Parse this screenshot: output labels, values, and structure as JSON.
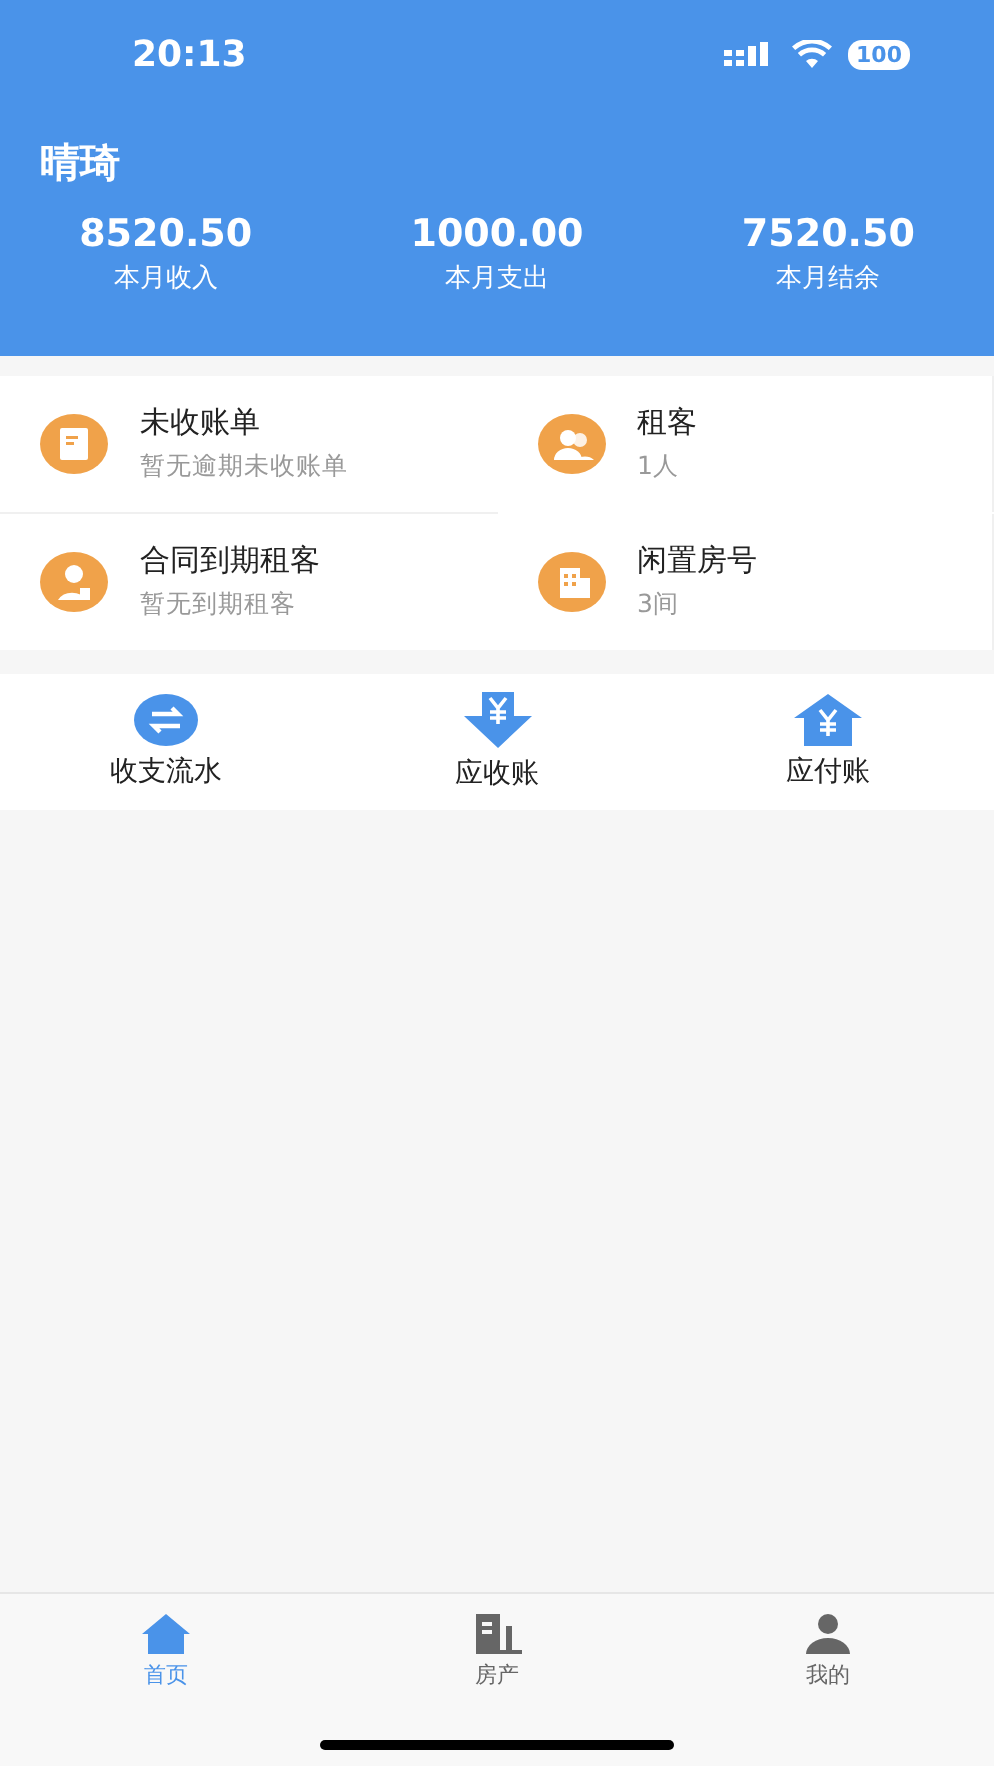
{
  "status_bar": {
    "time": "20:13",
    "battery": "100"
  },
  "header": {
    "title": "晴琦",
    "stats": [
      {
        "amount": "8520.50",
        "label": "本月收入"
      },
      {
        "amount": "1000.00",
        "label": "本月支出"
      },
      {
        "amount": "7520.50",
        "label": "本月结余"
      }
    ]
  },
  "cards": [
    {
      "title": "未收账单",
      "subtitle": "暂无逾期未收账单"
    },
    {
      "title": "租客",
      "subtitle": "1人"
    },
    {
      "title": "合同到期租客",
      "subtitle": "暂无到期租客"
    },
    {
      "title": "闲置房号",
      "subtitle": "3间"
    }
  ],
  "shortcuts": [
    {
      "label": "收支流水"
    },
    {
      "label": "应收账"
    },
    {
      "label": "应付账"
    }
  ],
  "tab_bar": [
    {
      "label": "首页",
      "selected": true
    },
    {
      "label": "房产",
      "selected": false
    },
    {
      "label": "我的",
      "selected": false
    }
  ]
}
